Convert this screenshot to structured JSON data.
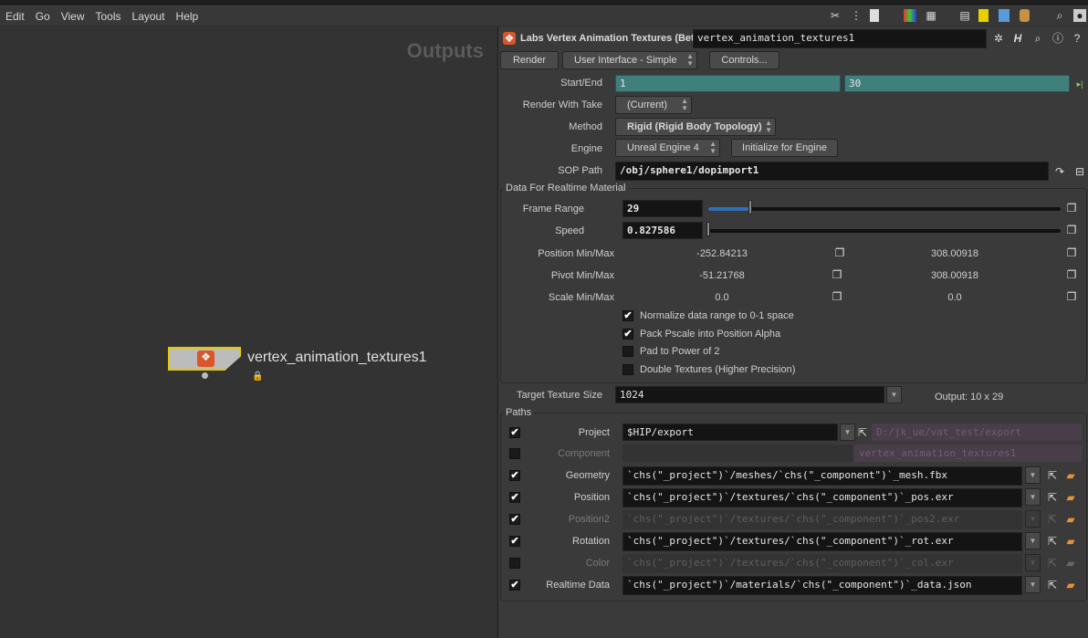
{
  "menu": [
    "Edit",
    "Go",
    "View",
    "Tools",
    "Layout",
    "Help"
  ],
  "network": {
    "title": "Outputs",
    "node_name": "vertex_animation_textures1"
  },
  "header": {
    "node_type": "Labs Vertex Animation Textures (Beta)",
    "node_name": "vertex_animation_textures1"
  },
  "toolbar": {
    "render": "Render",
    "ui_mode": "User Interface - Simple",
    "controls": "Controls..."
  },
  "params": {
    "start_end": {
      "label": "Start/End",
      "start": "1",
      "end": "30"
    },
    "take": {
      "label": "Render With Take",
      "value": "(Current)"
    },
    "method": {
      "label": "Method",
      "value": "Rigid  (Rigid Body Topology)"
    },
    "engine": {
      "label": "Engine",
      "value": "Unreal Engine 4",
      "init": "Initialize for Engine"
    },
    "sop_path": {
      "label": "SOP Path",
      "value": "/obj/sphere1/dopimport1"
    }
  },
  "realtime": {
    "title": "Data For Realtime Material",
    "frame_range": {
      "label": "Frame Range",
      "value": "29",
      "fraction": 0.12
    },
    "speed": {
      "label": "Speed",
      "value": "0.827586",
      "fraction": 0.0
    },
    "position": {
      "label": "Position Min/Max",
      "min": "-252.84213",
      "max": "308.00918"
    },
    "pivot": {
      "label": "Pivot Min/Max",
      "min": "-51.21768",
      "max": "308.00918"
    },
    "scale": {
      "label": "Scale Min/Max",
      "min": "0.0",
      "max": "0.0"
    },
    "checks": [
      {
        "label": "Normalize data range to 0-1 space",
        "checked": true
      },
      {
        "label": "Pack Pscale into Position Alpha",
        "checked": true
      },
      {
        "label": "Pad to Power of 2",
        "checked": false
      },
      {
        "label": "Double Textures (Higher Precision)",
        "checked": false
      }
    ]
  },
  "texture": {
    "label": "Target Texture Size",
    "value": "1024",
    "output": "Output: 10 x 29"
  },
  "paths": {
    "title": "Paths",
    "project": {
      "label": "Project",
      "value": "$HIP/export",
      "resolved": "D:/jk_ue/vat_test/export"
    },
    "component": {
      "label": "Component",
      "value": "",
      "resolved": "vertex_animation_textures1"
    },
    "rows": [
      {
        "label": "Geometry",
        "value": "`chs(\"_project\")`/meshes/`chs(\"_component\")`_mesh.fbx",
        "checked": true,
        "enabled": true
      },
      {
        "label": "Position",
        "value": "`chs(\"_project\")`/textures/`chs(\"_component\")`_pos.exr",
        "checked": true,
        "enabled": true
      },
      {
        "label": "Position2",
        "value": "`chs(\"_project\")`/textures/`chs(\"_component\")`_pos2.exr",
        "checked": true,
        "enabled": false
      },
      {
        "label": "Rotation",
        "value": "`chs(\"_project\")`/textures/`chs(\"_component\")`_rot.exr",
        "checked": true,
        "enabled": true
      },
      {
        "label": "Color",
        "value": "`chs(\"_project\")`/textures/`chs(\"_component\")`_col.exr",
        "checked": false,
        "enabled": false
      },
      {
        "label": "Realtime Data",
        "value": "`chs(\"_project\")`/materials/`chs(\"_component\")`_data.json",
        "checked": true,
        "enabled": true
      }
    ]
  }
}
